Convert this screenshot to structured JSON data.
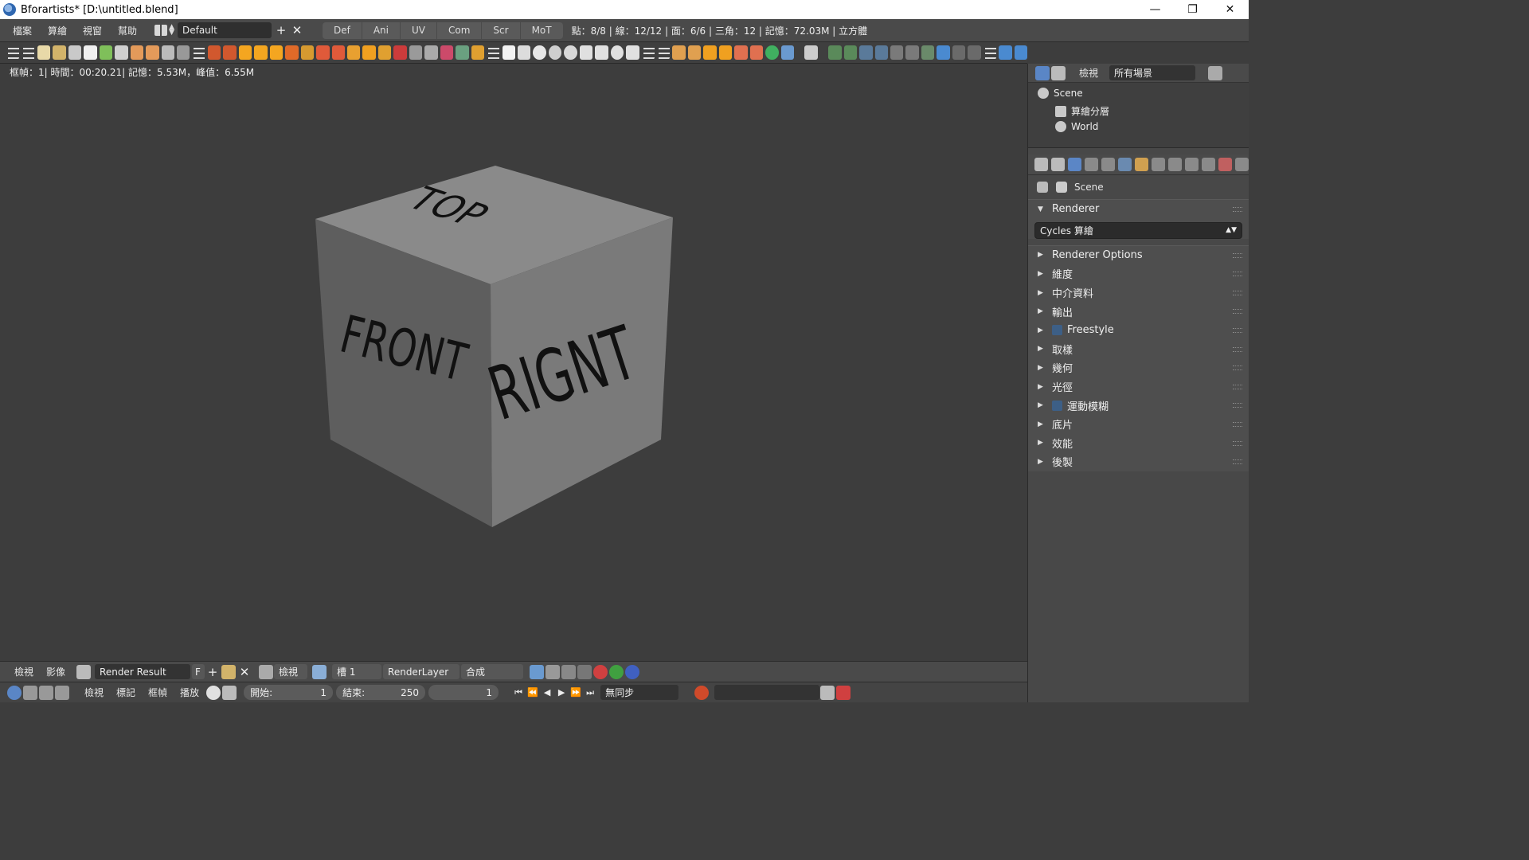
{
  "window": {
    "title": "Bforartists* [D:\\untitled.blend]",
    "minimize": "—",
    "restore": "❐",
    "close": "✕"
  },
  "info_header": {
    "menus": [
      "檔案",
      "算繪",
      "視窗",
      "幫助"
    ],
    "layout_name": "Default",
    "add_label": "+",
    "remove_label": "✕",
    "workspace_tabs": [
      "Def",
      "Ani",
      "UV",
      "Com",
      "Scr",
      "MoT"
    ],
    "stats": "點：8/8 | 線：12/12 | 面：6/6 | 三角：12 | 記憶：72.03M | 立方體"
  },
  "viewport": {
    "status": "框幀：1| 時間：00:20.21| 記憶：5.53M，峰值：6.55M",
    "cube_labels": {
      "top": "TOP",
      "front": "FRONT",
      "right": "RIGNT"
    }
  },
  "image_header": {
    "menus": [
      "檢視",
      "影像"
    ],
    "image_name": "Render Result",
    "fake_user": "F",
    "view_label": "檢視",
    "slot": "槽 1",
    "layer": "RenderLayer",
    "pass": "合成"
  },
  "timeline": {
    "menus": [
      "檢視",
      "標記",
      "框幀",
      "播放"
    ],
    "start_label": "開始:",
    "start_value": "1",
    "end_label": "結束:",
    "end_value": "250",
    "current_frame": "1",
    "sync": "無同步"
  },
  "outliner": {
    "view_label": "檢視",
    "filter": "所有場景",
    "items": [
      "Scene",
      "算繪分層",
      "World"
    ]
  },
  "properties": {
    "context": "Scene",
    "renderer_header": "Renderer",
    "render_engine": "Cycles 算繪",
    "sections": [
      {
        "label": "Renderer Options",
        "checkbox": false
      },
      {
        "label": "維度",
        "checkbox": false
      },
      {
        "label": "中介資料",
        "checkbox": false
      },
      {
        "label": "輸出",
        "checkbox": false
      },
      {
        "label": "Freestyle",
        "checkbox": true
      },
      {
        "label": "取樣",
        "checkbox": false
      },
      {
        "label": "幾何",
        "checkbox": false
      },
      {
        "label": "光徑",
        "checkbox": false
      },
      {
        "label": "運動模糊",
        "checkbox": true
      },
      {
        "label": "底片",
        "checkbox": false
      },
      {
        "label": "效能",
        "checkbox": false
      },
      {
        "label": "後製",
        "checkbox": false
      }
    ]
  },
  "colors": {
    "accent": "#5b86c6",
    "viewport_bg": "#3d3d3d",
    "header_bg": "#4a4a4a"
  }
}
